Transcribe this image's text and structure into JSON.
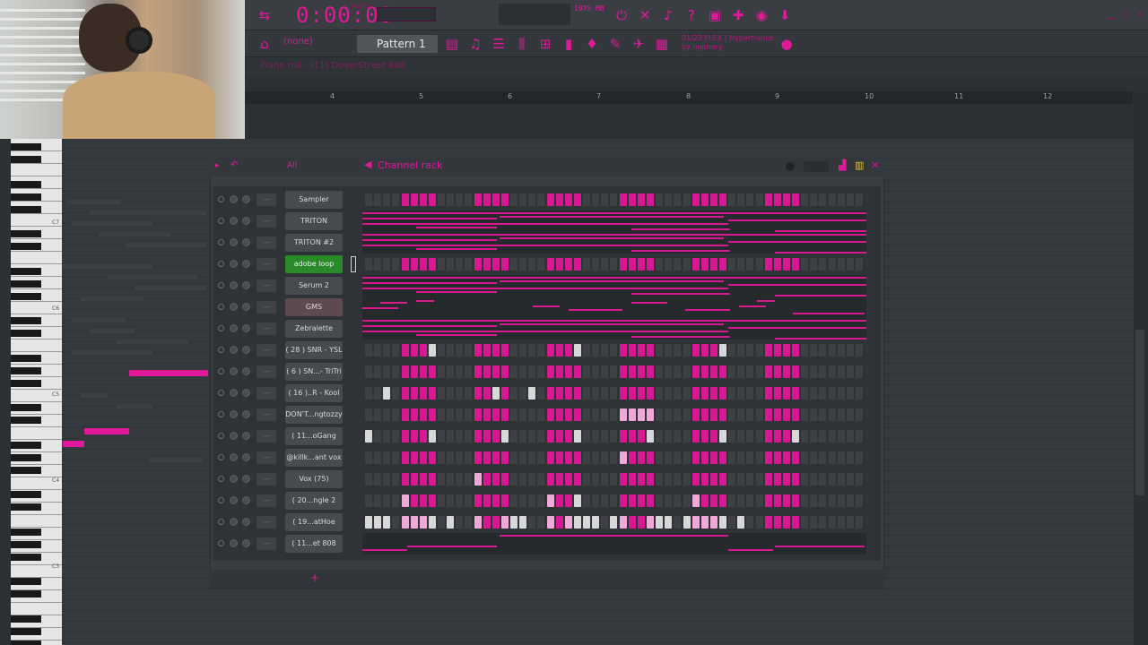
{
  "toolbar": {
    "time": "0:00:00",
    "time_unit": "M:S:CS",
    "memory": "1975 MB",
    "pattern": "Pattern 1",
    "snap": "(none)",
    "song_info": [
      "01/23 FLEX | Hypertrance",
      "by nuphory"
    ]
  },
  "piano_roll": {
    "title": "Piano roll - (11) DoverStreet 808",
    "ruler": [
      "4",
      "5",
      "6",
      "7",
      "8",
      "9",
      "10",
      "11",
      "12"
    ],
    "octaves": [
      "C7",
      "C6",
      "C5",
      "C4",
      "C3"
    ]
  },
  "channel_rack": {
    "title": "Channel rack",
    "filter": "All",
    "add_label": "+",
    "channels": [
      {
        "name": "Sampler",
        "kind": "steps",
        "sel": false
      },
      {
        "name": "TRITON",
        "kind": "roll",
        "sel": false
      },
      {
        "name": "TRITON #2",
        "kind": "roll",
        "sel": false
      },
      {
        "name": "adobe loop",
        "kind": "steps",
        "sel": true
      },
      {
        "name": "Serum 2",
        "kind": "roll",
        "sel": false
      },
      {
        "name": "GMS",
        "kind": "roll",
        "sel": false
      },
      {
        "name": "Zebralette",
        "kind": "roll",
        "sel": false
      },
      {
        "name": "( 28 ) SNR - YSL",
        "kind": "steps",
        "sel": false
      },
      {
        "name": "( 6 ) SN...- TriTri",
        "kind": "steps",
        "sel": false
      },
      {
        "name": "( 16 )..R - Kool",
        "kind": "steps",
        "sel": false
      },
      {
        "name": "DON'T...ngtozzy",
        "kind": "steps",
        "sel": false
      },
      {
        "name": "( 11...oGang",
        "kind": "steps",
        "sel": false
      },
      {
        "name": "@killk...ant vox",
        "kind": "steps",
        "sel": false
      },
      {
        "name": "Vox (75)",
        "kind": "steps",
        "sel": false
      },
      {
        "name": "( 20...ngle 2",
        "kind": "steps",
        "sel": false
      },
      {
        "name": "( 19...atHoe",
        "kind": "steps",
        "sel": false
      },
      {
        "name": "( 11...et 808",
        "kind": "roll",
        "sel": false
      }
    ],
    "mixer_label": "---"
  },
  "colors": {
    "accent": "#e0189a",
    "step_off": "#3d4145",
    "step_on": "#d81890",
    "step_white": "#d8d8d8",
    "step_pink_light": "#f0a8d8"
  }
}
